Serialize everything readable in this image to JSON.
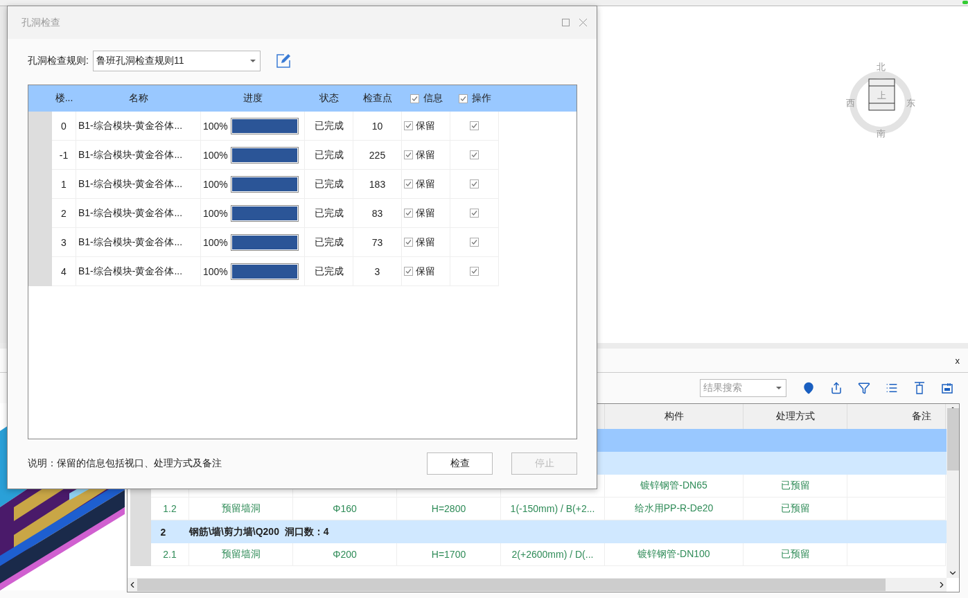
{
  "viewport": {
    "compass": {
      "north": "北",
      "east": "东",
      "south": "南",
      "west": "西",
      "top": "上"
    }
  },
  "results_panel": {
    "close": "x",
    "search_placeholder": "结果搜索",
    "columns": [
      {},
      {},
      {},
      {},
      {},
      {
        "label": "构件"
      },
      {
        "label": "处理方式"
      },
      {
        "label": "备注"
      }
    ],
    "rows": [
      {
        "kind": "blank",
        "selected": true
      },
      {
        "kind": "blank_group",
        "selected": false
      },
      {
        "kind": "partial",
        "selected": false,
        "cells": [
          "镀锌钢管-DN65",
          "已预留"
        ]
      },
      {
        "kind": "item",
        "selected": false,
        "cells": [
          "1.2",
          "预留墙洞",
          "Φ160",
          "H=2800",
          "1(-150mm) / B(+2...",
          "给水用PP-R-De20",
          "已预留"
        ]
      },
      {
        "kind": "group",
        "selected": false,
        "number": "2",
        "label": "钢筋\\墙\\剪力墙\\Q200  洞口数：4"
      },
      {
        "kind": "item",
        "selected": false,
        "cells": [
          "2.1",
          "预留墙洞",
          "Φ200",
          "H=1700",
          "2(+2600mm) / D(...",
          "镀锌钢管-DN100",
          "已预留"
        ]
      }
    ]
  },
  "dialog": {
    "title": "孔洞检查",
    "rule_label": "孔洞检查规则:",
    "rule_value": "鲁班孔洞检查规则11",
    "columns": [
      {
        "label": "楼...",
        "kind": "text"
      },
      {
        "label": "名称",
        "kind": "text"
      },
      {
        "label": "进度",
        "kind": "text"
      },
      {
        "label": "状态",
        "kind": "text"
      },
      {
        "label": "检查点",
        "kind": "text"
      },
      {
        "label": "信息",
        "kind": "checkbox",
        "checked": true
      },
      {
        "label": "操作",
        "kind": "checkbox",
        "checked": true
      }
    ],
    "rows": [
      {
        "floor": "0",
        "name": "B1-综合模块-黄金谷体...",
        "progress": "100%",
        "level": 1,
        "status": "已完成",
        "points": "10",
        "keep": true,
        "keep_label": "保留",
        "action": true
      },
      {
        "floor": "-1",
        "name": "B1-综合模块-黄金谷体...",
        "progress": "100%",
        "level": 1,
        "status": "已完成",
        "points": "225",
        "keep": true,
        "keep_label": "保留",
        "action": true
      },
      {
        "floor": "1",
        "name": "B1-综合模块-黄金谷体...",
        "progress": "100%",
        "level": 1,
        "status": "已完成",
        "points": "183",
        "keep": true,
        "keep_label": "保留",
        "action": true
      },
      {
        "floor": "2",
        "name": "B1-综合模块-黄金谷体...",
        "progress": "100%",
        "level": 1,
        "status": "已完成",
        "points": "83",
        "keep": true,
        "keep_label": "保留",
        "action": true
      },
      {
        "floor": "3",
        "name": "B1-综合模块-黄金谷体...",
        "progress": "100%",
        "level": 1,
        "status": "已完成",
        "points": "73",
        "keep": true,
        "keep_label": "保留",
        "action": true
      },
      {
        "floor": "4",
        "name": "B1-综合模块-黄金谷体...",
        "progress": "100%",
        "level": 1,
        "status": "已完成",
        "points": "3",
        "keep": true,
        "keep_label": "保留",
        "action": true
      }
    ],
    "note": "说明：保留的信息包括视口、处理方式及备注",
    "buttons": [
      {
        "label": "检查",
        "disabled": false
      },
      {
        "label": "停止",
        "disabled": true
      }
    ]
  }
}
